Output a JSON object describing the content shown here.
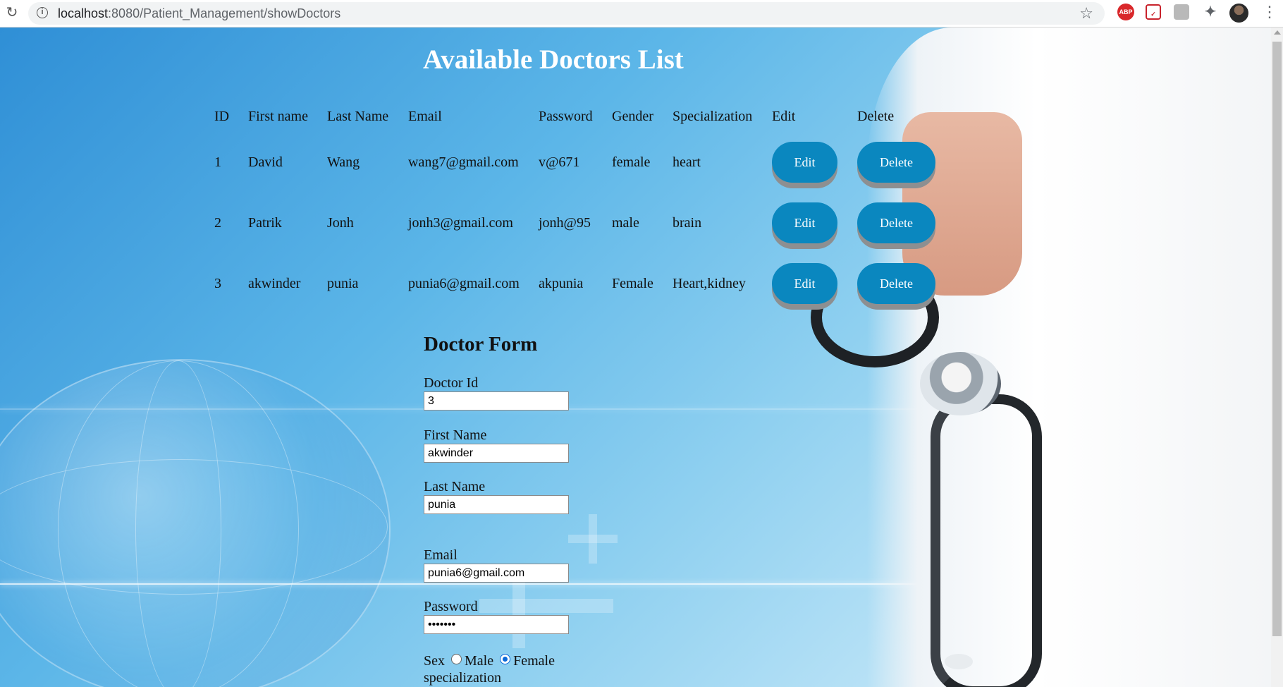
{
  "browser": {
    "url_host": "localhost",
    "url_rest": ":8080/Patient_Management/showDoctors",
    "extensions": [
      "reload-icon",
      "star-icon",
      "adblock-icon",
      "pocket-icon",
      "extension-icon",
      "puzzle-icon",
      "profile-avatar",
      "menu-icon"
    ],
    "abp_label": "ABP"
  },
  "page": {
    "title": "Available Doctors List",
    "table": {
      "headers": [
        "ID",
        "First name",
        "Last Name",
        "Email",
        "Password",
        "Gender",
        "Specialization",
        "Edit",
        "Delete"
      ],
      "rows": [
        {
          "id": "1",
          "first": "David",
          "last": "Wang",
          "email": "wang7@gmail.com",
          "password": "v@671",
          "gender": "female",
          "specialization": "heart"
        },
        {
          "id": "2",
          "first": "Patrik",
          "last": "Jonh",
          "email": "jonh3@gmail.com",
          "password": "jonh@95",
          "gender": "male",
          "specialization": "brain"
        },
        {
          "id": "3",
          "first": "akwinder",
          "last": "punia",
          "email": "punia6@gmail.com",
          "password": "akpunia",
          "gender": "Female",
          "specialization": "Heart,kidney"
        }
      ],
      "edit_label": "Edit",
      "delete_label": "Delete"
    },
    "form": {
      "title": "Doctor Form",
      "doctor_id_label": "Doctor Id",
      "doctor_id_value": "3",
      "first_name_label": "First Name",
      "first_name_value": "akwinder",
      "last_name_label": "Last Name",
      "last_name_value": "punia",
      "email_label": "Email",
      "email_value": "punia6@gmail.com",
      "password_label": "Password",
      "password_value": "•••••••",
      "sex_label": "Sex",
      "male_label": "Male",
      "female_label": "Female",
      "selected_sex": "Female",
      "specialization_label": "specialization"
    }
  },
  "colors": {
    "button": "#0a87bf",
    "button_shadow": "#8d8f91",
    "title": "#ffffff",
    "radio_selected": "#0b68d8"
  }
}
